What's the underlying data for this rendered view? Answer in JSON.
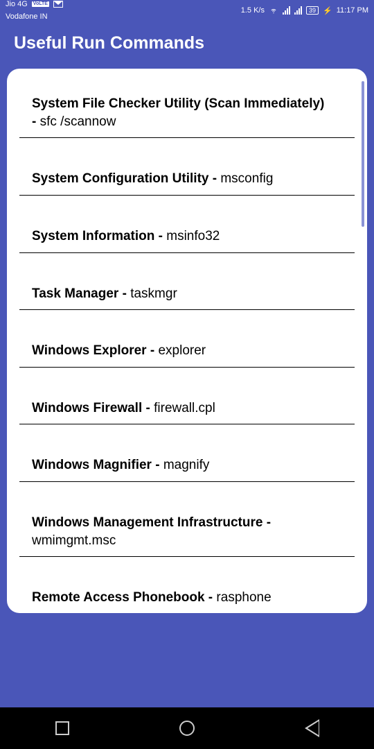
{
  "status": {
    "carrier_top": "Jio 4G",
    "volte": "VoLTE",
    "carrier_bottom": "Vodafone IN",
    "speed": "1.5 K/s",
    "battery": "39",
    "time": "11:17 PM"
  },
  "header": {
    "title": "Useful Run Commands"
  },
  "commands": [
    {
      "title": "System File Checker Utility (Scan Immediately)",
      "cmd": "sfc /scannow",
      "twoline": true
    },
    {
      "title": "System Configuration Utility",
      "cmd": "msconfig"
    },
    {
      "title": "System Information",
      "cmd": "msinfo32"
    },
    {
      "title": "Task Manager",
      "cmd": "taskmgr"
    },
    {
      "title": "Windows Explorer",
      "cmd": "explorer"
    },
    {
      "title": "Windows Firewall",
      "cmd": "firewall.cpl"
    },
    {
      "title": "Windows Magnifier",
      "cmd": "magnify"
    },
    {
      "title": "Windows Management Infrastructure",
      "cmd": "wmimgmt.msc"
    },
    {
      "title": "Remote Access Phonebook",
      "cmd": "rasphone"
    }
  ]
}
